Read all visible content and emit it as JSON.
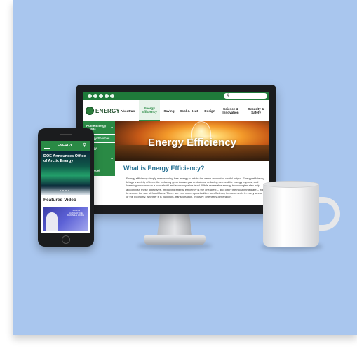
{
  "desktop": {
    "logo": "ENERGY",
    "nav": [
      "About Us",
      "Energy Efficiency",
      "Saving",
      "Cool & Heat",
      "Design",
      "Science & Innovation",
      "Security & Safety"
    ],
    "sidebar": [
      {
        "label": "Home Energy Audits"
      },
      {
        "label": "Energy Sources"
      },
      {
        "label": "Energy"
      },
      {
        "label": "city"
      },
      {
        "label": "es & Fuel"
      }
    ],
    "hero_title": "Energy Efficiency",
    "content_title": "What is Energy Efficiency?",
    "content_body": "Energy efficiency simply means using less energy to attain the same amount of useful output. Energy efficiency brings a variety of benefits: reducing greenhouse gas emissions, reducing demand for energy imports, and lowering our costs on a household and economy-wide level. While renewable energy technologies also help accomplish these objectives, improving energy efficiency is the cheapest – and often the most immediate – way to reduce the use of fossil fuels. There are enormous opportunities for efficiency improvements in every sector of the economy, whether it is buildings, transportation, industry, or energy-generation."
  },
  "mobile": {
    "logo": "ENERGY",
    "hero_title": "DOE Announces Office of Arctic Energy",
    "featured_title": "Featured Video",
    "thumb_text": "PLUG-IN AUTOMOTIVE DURABLE ACIDS"
  }
}
